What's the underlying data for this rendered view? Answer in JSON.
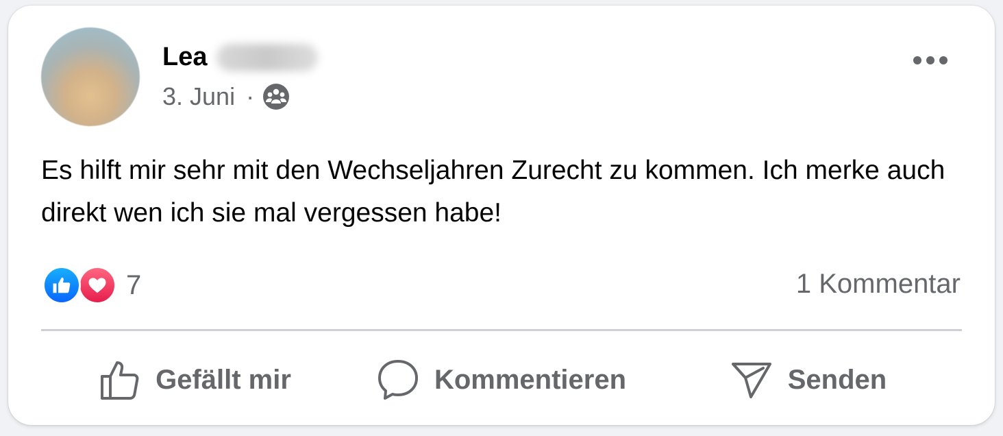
{
  "post": {
    "author": "Lea",
    "date": "3. Juni",
    "separator": "·",
    "audience_icon": "friends-icon",
    "text": "Es hilft mir sehr mit den Wechseljahren Zurecht zu kommen. Ich merke auch direkt wen ich sie mal vergessen habe!",
    "reactions": {
      "types": [
        "like",
        "love"
      ],
      "count": "7"
    },
    "comments_label": "1 Kommentar"
  },
  "actions": {
    "like_label": "Gefällt mir",
    "comment_label": "Kommentieren",
    "send_label": "Senden"
  },
  "colors": {
    "like_blue": "#0866ff",
    "love_red": "#e61e4d",
    "secondary_text": "#65676b",
    "primary_text": "#050505"
  }
}
